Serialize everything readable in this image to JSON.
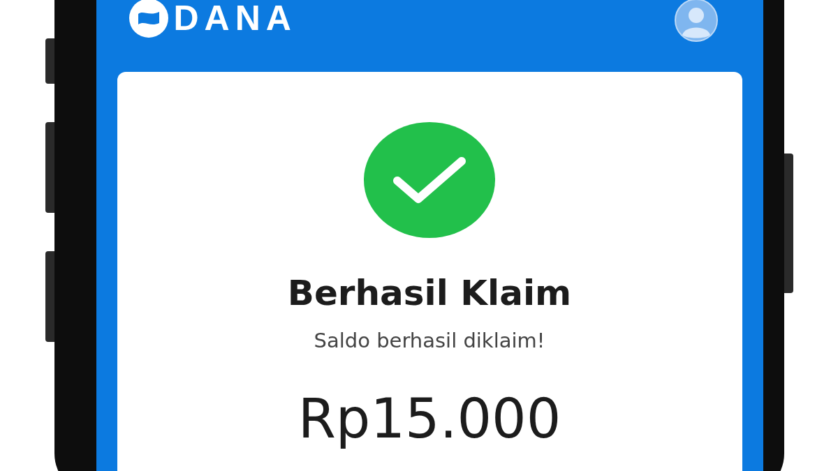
{
  "header": {
    "brand": "DANA"
  },
  "result": {
    "succeeded": true,
    "title": "Berhasil Klaim",
    "message": "Saldo berhasil diklaim!",
    "amount": "Rp15.000"
  }
}
